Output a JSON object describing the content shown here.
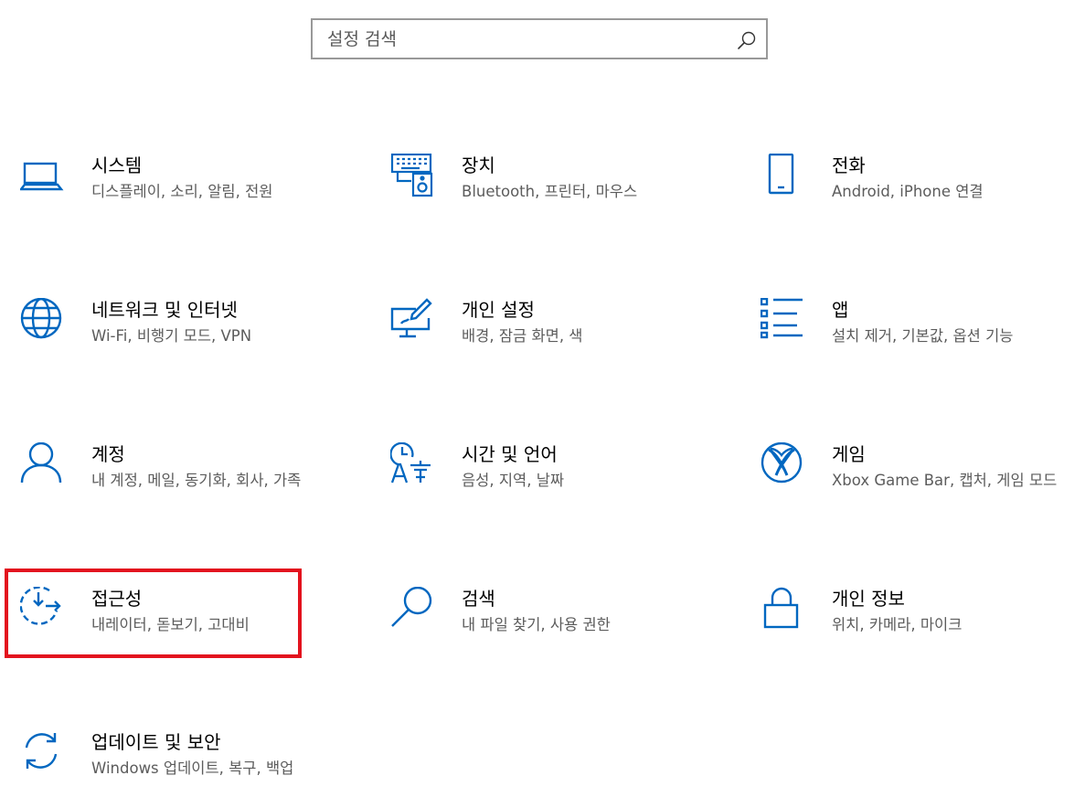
{
  "search": {
    "placeholder": "설정 검색",
    "icon": "search-icon"
  },
  "colors": {
    "accent": "#0067c0",
    "highlight": "#e3131e"
  },
  "tiles": [
    {
      "title": "시스템",
      "desc": "디스플레이, 소리, 알림, 전원",
      "icon": "laptop-icon"
    },
    {
      "title": "장치",
      "desc": "Bluetooth, 프린터, 마우스",
      "icon": "devices-icon"
    },
    {
      "title": "전화",
      "desc": "Android, iPhone 연결",
      "icon": "phone-icon"
    },
    {
      "title": "네트워크 및 인터넷",
      "desc": "Wi-Fi, 비행기 모드, VPN",
      "icon": "globe-icon"
    },
    {
      "title": "개인 설정",
      "desc": "배경, 잠금 화면, 색",
      "icon": "personalization-icon"
    },
    {
      "title": "앱",
      "desc": "설치 제거, 기본값, 옵션 기능",
      "icon": "apps-list-icon"
    },
    {
      "title": "계정",
      "desc": "내 계정, 메일, 동기화, 회사, 가족",
      "icon": "person-icon"
    },
    {
      "title": "시간 및 언어",
      "desc": "음성, 지역, 날짜",
      "icon": "time-language-icon"
    },
    {
      "title": "게임",
      "desc": "Xbox Game Bar, 캡처, 게임 모드",
      "icon": "xbox-icon"
    },
    {
      "title": "접근성",
      "desc": "내레이터, 돋보기, 고대비",
      "icon": "accessibility-icon"
    },
    {
      "title": "검색",
      "desc": "내 파일 찾기, 사용 권한",
      "icon": "magnifier-icon"
    },
    {
      "title": "개인 정보",
      "desc": "위치, 카메라, 마이크",
      "icon": "lock-icon"
    },
    {
      "title": "업데이트 및 보안",
      "desc": "Windows 업데이트, 복구, 백업",
      "icon": "update-sync-icon"
    }
  ]
}
